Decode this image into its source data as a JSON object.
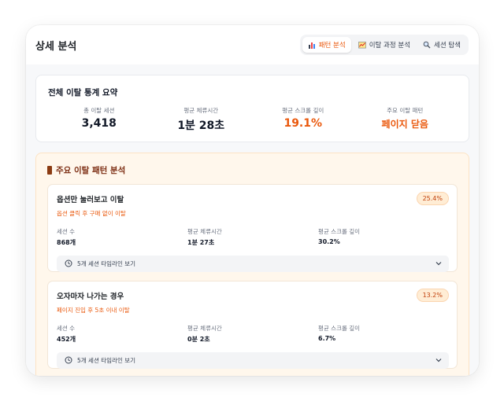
{
  "header": {
    "title": "상세 분석",
    "tabs": [
      {
        "label": "패턴 분석",
        "icon": "bar-chart-icon",
        "active": true
      },
      {
        "label": "이탈 과정 분석",
        "icon": "line-chart-icon",
        "active": false
      },
      {
        "label": "세션 탐색",
        "icon": "search-icon",
        "active": false
      }
    ]
  },
  "summary": {
    "title": "전체 이탈 통계 요약",
    "stats": [
      {
        "label": "총 이탈 세션",
        "value": "3,418"
      },
      {
        "label": "평균 체류시간",
        "value": "1분 28초"
      },
      {
        "label": "평균 스크롤 깊이",
        "value": "19.1%"
      },
      {
        "label": "주요 이탈 패턴",
        "value": "페이지 닫음"
      }
    ]
  },
  "patterns": {
    "title": "주요 이탈 패턴 분석",
    "items": [
      {
        "title": "옵션만 눌러보고 이탈",
        "percent": "25.4%",
        "subtitle": "옵션 클릭 후 구매 없이 이탈",
        "stats": [
          {
            "label": "세션 수",
            "value": "868개"
          },
          {
            "label": "평균 체류시간",
            "value": "1분 27초"
          },
          {
            "label": "평균 스크롤 깊이",
            "value": "30.2%"
          }
        ],
        "timeline_label": "5개 세션 타임라인 보기"
      },
      {
        "title": "오자마자 나가는 경우",
        "percent": "13.2%",
        "subtitle": "페이지 진입 후 5초 이내 이탈",
        "stats": [
          {
            "label": "세션 수",
            "value": "452개"
          },
          {
            "label": "평균 체류시간",
            "value": "0분 2초"
          },
          {
            "label": "평균 스크롤 깊이",
            "value": "6.7%"
          }
        ],
        "timeline_label": "5개 세션 타임라인 보기"
      }
    ]
  },
  "colors": {
    "accent": "#ea580c",
    "pattern_bg": "#fff7ec",
    "pattern_title": "#7c2d12"
  }
}
